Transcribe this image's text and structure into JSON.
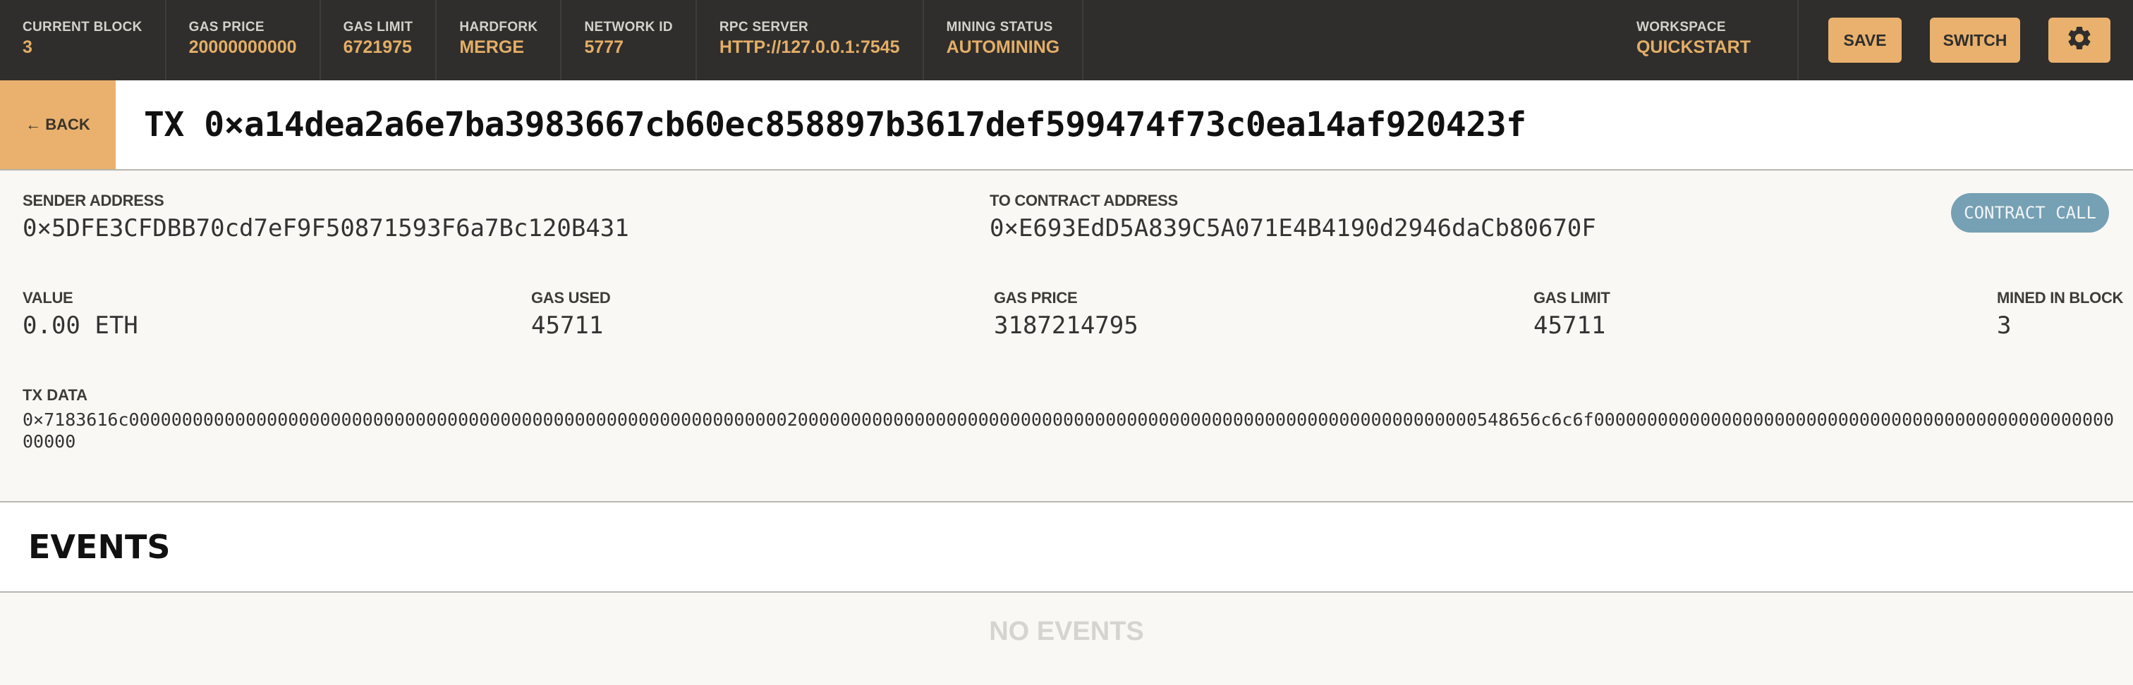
{
  "topbar": {
    "stats": [
      {
        "label": "CURRENT BLOCK",
        "value": "3"
      },
      {
        "label": "GAS PRICE",
        "value": "20000000000"
      },
      {
        "label": "GAS LIMIT",
        "value": "6721975"
      },
      {
        "label": "HARDFORK",
        "value": "MERGE"
      },
      {
        "label": "NETWORK ID",
        "value": "5777"
      },
      {
        "label": "RPC SERVER",
        "value": "HTTP://127.0.0.1:7545"
      },
      {
        "label": "MINING STATUS",
        "value": "AUTOMINING"
      }
    ],
    "workspace": {
      "label": "WORKSPACE",
      "value": "QUICKSTART"
    },
    "save_label": "SAVE",
    "switch_label": "SWITCH",
    "settings_icon": "gear-icon"
  },
  "title": {
    "back_label": "← BACK",
    "tx_title": "TX 0×a14dea2a6e7ba3983667cb60ec858897b3617def599474f73c0ea14af920423f"
  },
  "detail": {
    "sender": {
      "label": "SENDER ADDRESS",
      "value": "0×5DFE3CFDBB70cd7eF9F50871593F6a7Bc120B431"
    },
    "to": {
      "label": "TO CONTRACT ADDRESS",
      "value": "0×E693EdD5A839C5A071E4B4190d2946daCb80670F"
    },
    "badge": "CONTRACT CALL",
    "value": {
      "label": "VALUE",
      "value": "0.00 ETH"
    },
    "gas_used": {
      "label": "GAS USED",
      "value": "45711"
    },
    "gas_price": {
      "label": "GAS PRICE",
      "value": "3187214795"
    },
    "gas_limit": {
      "label": "GAS LIMIT",
      "value": "45711"
    },
    "mined_in_block": {
      "label": "MINED IN BLOCK",
      "value": "3"
    },
    "tx_data": {
      "label": "TX DATA",
      "value": "0×7183616c0000000000000000000000000000000000000000000000000000000000000020000000000000000000000000000000000000000000000000000000000000000548656c6c6f000000000000000000000000000000000000000000000000000000"
    }
  },
  "events": {
    "heading": "EVENTS",
    "empty_label": "NO EVENTS"
  },
  "colors": {
    "topbar_bg": "#2f2e2c",
    "accent": "#e9b16d",
    "stat_value": "#e4ae67",
    "badge": "#76a0b4",
    "panel_bg": "#f9f8f5"
  }
}
